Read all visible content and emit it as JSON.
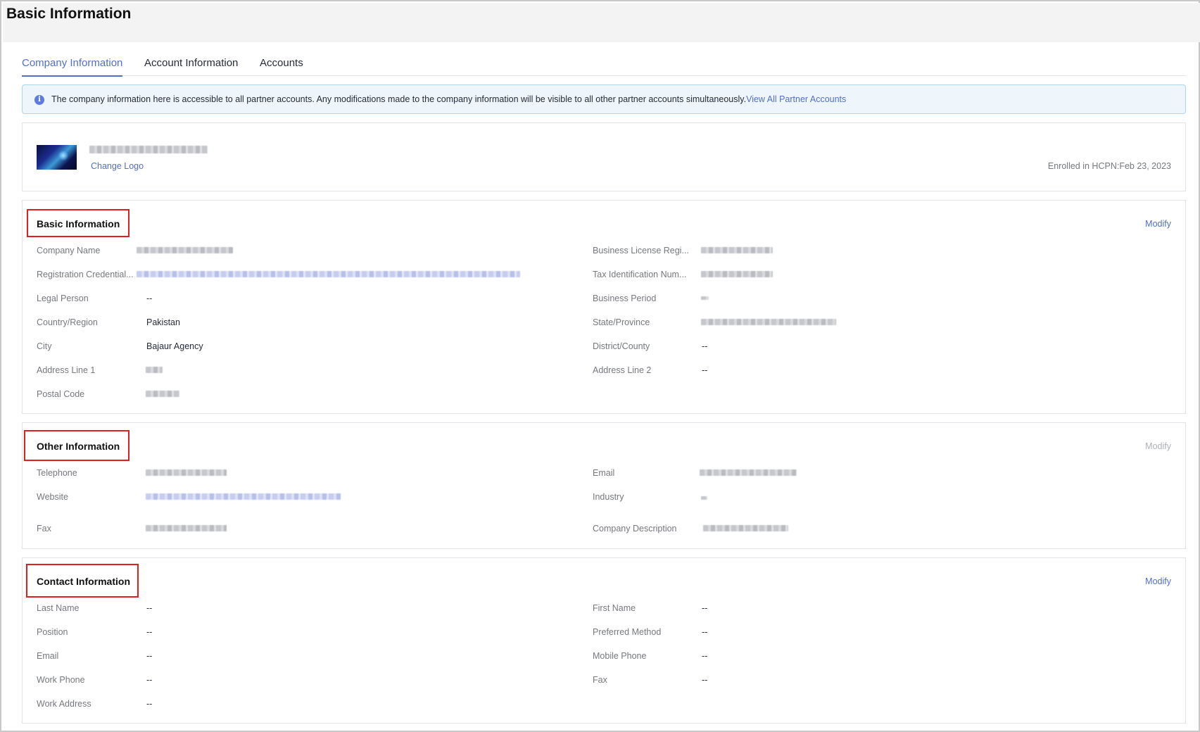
{
  "page": {
    "title": "Basic Information"
  },
  "tabs": [
    {
      "label": "Company Information",
      "active": true
    },
    {
      "label": "Account Information",
      "active": false
    },
    {
      "label": "Accounts",
      "active": false
    }
  ],
  "notice": {
    "text": "The company information here is accessible to all partner accounts. Any modifications made to the company information will be visible to all other partner accounts simultaneously.",
    "link": "View All Partner Accounts"
  },
  "logo_card": {
    "change_logo": "Change Logo",
    "enrolled": "Enrolled in HCPN:Feb 23, 2023"
  },
  "basic_info": {
    "title": "Basic Information",
    "modify": "Modify",
    "left": [
      {
        "label": "Company Name",
        "value": ""
      },
      {
        "label": "Registration Credential...",
        "value": ""
      },
      {
        "label": "Legal Person",
        "value": "--"
      },
      {
        "label": "Country/Region",
        "value": "Pakistan"
      },
      {
        "label": "City",
        "value": "Bajaur Agency"
      },
      {
        "label": "Address Line 1",
        "value": ""
      },
      {
        "label": "Postal Code",
        "value": ""
      }
    ],
    "right": [
      {
        "label": "Business License Regi...",
        "value": ""
      },
      {
        "label": "Tax Identification Num...",
        "value": ""
      },
      {
        "label": "Business Period",
        "value": ""
      },
      {
        "label": "State/Province",
        "value": ""
      },
      {
        "label": "District/County",
        "value": "--"
      },
      {
        "label": "Address Line 2",
        "value": "--"
      }
    ]
  },
  "other_info": {
    "title": "Other Information",
    "modify": "Modify",
    "left": [
      {
        "label": "Telephone",
        "value": ""
      },
      {
        "label": "Website",
        "value": ""
      },
      {
        "label": "Fax",
        "value": ""
      }
    ],
    "right": [
      {
        "label": "Email",
        "value": ""
      },
      {
        "label": "Industry",
        "value": ""
      },
      {
        "label": "Company Description",
        "value": ""
      }
    ]
  },
  "contact_info": {
    "title": "Contact Information",
    "modify": "Modify",
    "left": [
      {
        "label": "Last Name",
        "value": "--"
      },
      {
        "label": "Position",
        "value": "--"
      },
      {
        "label": "Email",
        "value": "--"
      },
      {
        "label": "Work Phone",
        "value": "--"
      },
      {
        "label": "Work Address",
        "value": "--"
      }
    ],
    "right": [
      {
        "label": "First Name",
        "value": "--"
      },
      {
        "label": "Preferred Method",
        "value": "--"
      },
      {
        "label": "Mobile Phone",
        "value": "--"
      },
      {
        "label": "Fax",
        "value": "--"
      }
    ]
  },
  "colors": {
    "accent": "#526ecc",
    "highlight_border": "#e02020",
    "notice_bg": "#eef6fc"
  }
}
